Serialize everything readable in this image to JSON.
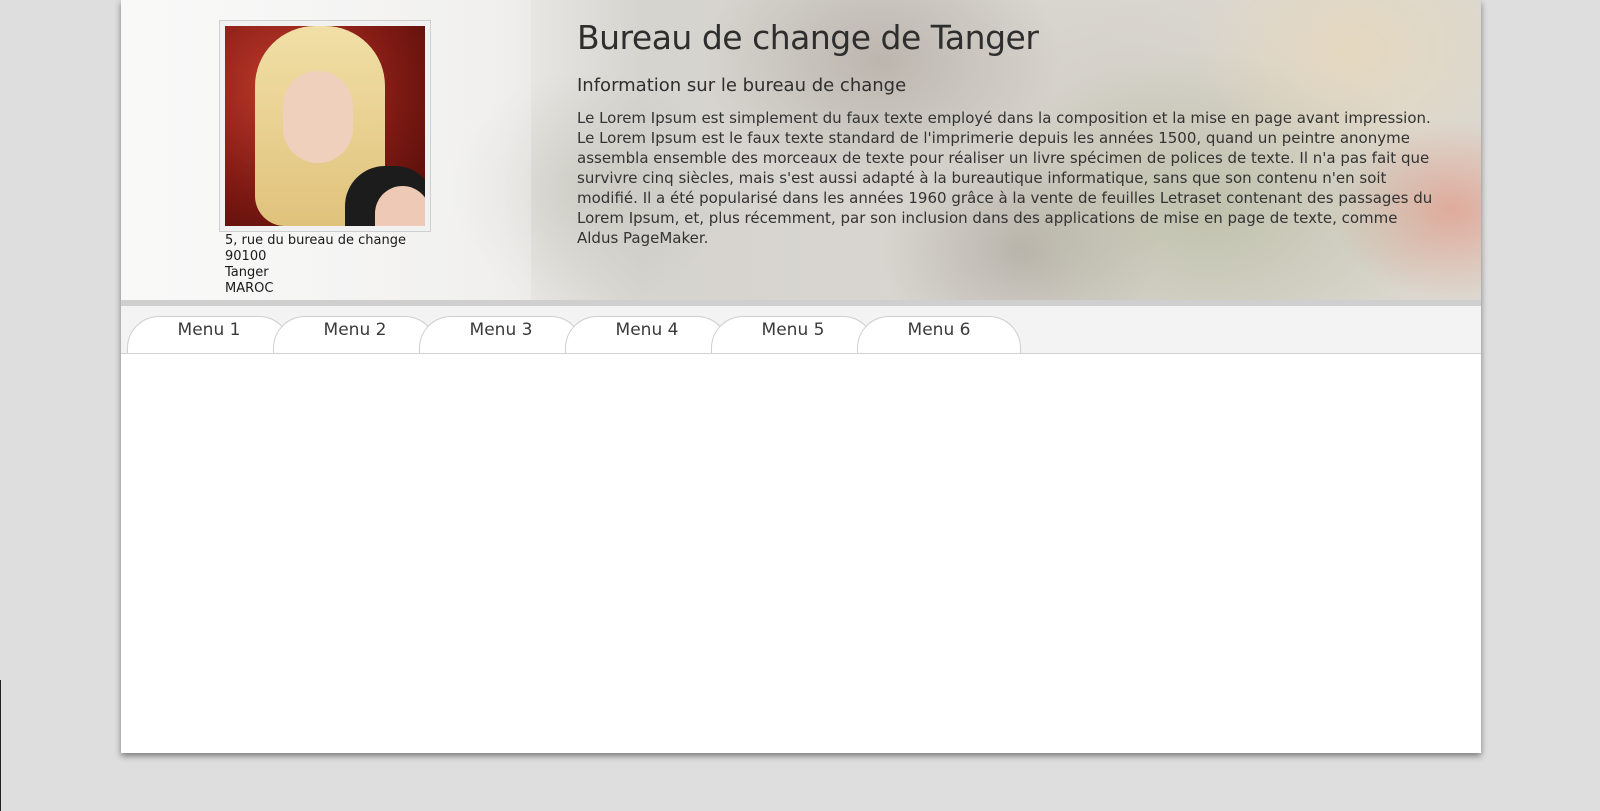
{
  "header": {
    "title": "Bureau de change de Tanger",
    "subtitle": "Information sur le bureau de change",
    "paragraph": "Le Lorem Ipsum est simplement du faux texte employé dans la composition et la mise en page avant impression. Le Lorem Ipsum est le faux texte standard de l'imprimerie depuis les années 1500, quand un peintre anonyme assembla ensemble des morceaux de texte pour réaliser un livre spécimen de polices de texte. Il n'a pas fait que survivre cinq siècles, mais s'est aussi adapté à la bureautique informatique, sans que son contenu n'en soit modifié. Il a été popularisé dans les années 1960 grâce à la vente de feuilles Letraset contenant des passages du Lorem Ipsum, et, plus récemment, par son inclusion dans des applications de mise en page de texte, comme Aldus PageMaker."
  },
  "address": {
    "street": "5, rue du bureau de change",
    "postal_code": "90100",
    "city": "Tanger",
    "country": "MAROC"
  },
  "menu": {
    "items": [
      {
        "label": "Menu 1"
      },
      {
        "label": "Menu 2"
      },
      {
        "label": "Menu 3"
      },
      {
        "label": "Menu 4"
      },
      {
        "label": "Menu 5"
      },
      {
        "label": "Menu 6"
      }
    ]
  },
  "colors": {
    "page_background": "#dedede",
    "content_background": "#ffffff",
    "menu_bar_background": "#f3f3f3",
    "text": "#333333"
  }
}
